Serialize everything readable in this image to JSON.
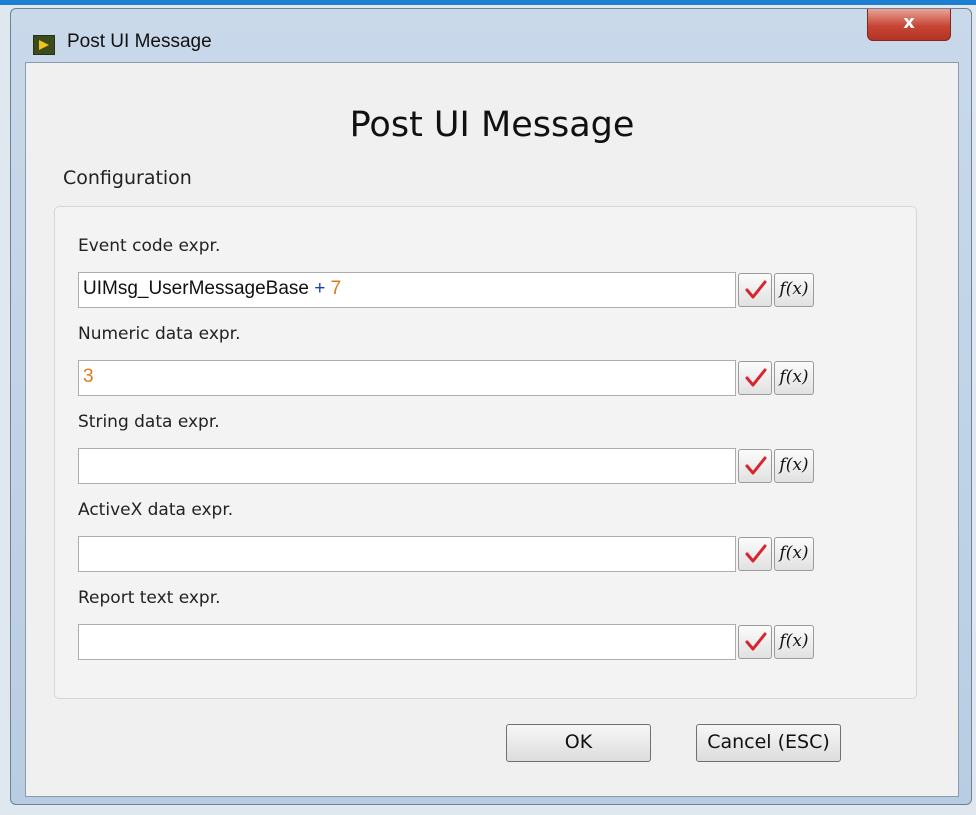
{
  "window": {
    "title": "Post UI Message",
    "close_glyph": "x"
  },
  "dialog": {
    "heading": "Post UI Message",
    "section_label": "Configuration"
  },
  "fields": [
    {
      "label": "Event code expr.",
      "value_tokens": [
        {
          "text": "UIMsg_UserMessageBase",
          "kind": "identifier"
        },
        {
          "text": " + ",
          "kind": "operator"
        },
        {
          "text": "7",
          "kind": "number"
        }
      ]
    },
    {
      "label": "Numeric data expr.",
      "value_tokens": [
        {
          "text": "3",
          "kind": "number"
        }
      ]
    },
    {
      "label": "String data expr.",
      "value_tokens": []
    },
    {
      "label": "ActiveX data expr.",
      "value_tokens": []
    },
    {
      "label": "Report text expr.",
      "value_tokens": []
    }
  ],
  "field_buttons": {
    "check_icon": "check-icon",
    "fx_label": "f(x)"
  },
  "buttons": {
    "ok_label": "OK",
    "cancel_label": "Cancel (ESC)"
  },
  "colors": {
    "identifier": "#111111",
    "operator": "#1f3fb0",
    "number": "#e07b1c",
    "check": "#d9232e",
    "close_button": "#c74534"
  }
}
